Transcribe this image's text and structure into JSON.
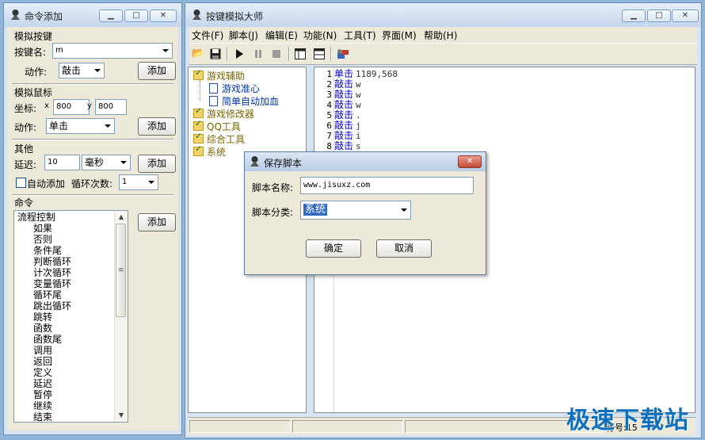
{
  "left_window": {
    "title": "命令添加",
    "key_group": {
      "title": "模拟按键",
      "key_label": "按键名:",
      "key_value": "m",
      "action_label": "动作:",
      "action_value": "敲击",
      "add_label": "添加"
    },
    "mouse_group": {
      "title": "模拟鼠标",
      "coord_label": "坐标:",
      "x_label": "x",
      "x_value": "800",
      "y_label": "y",
      "y_value": "800",
      "action_label": "动作:",
      "action_value": "单击",
      "add_label": "添加"
    },
    "other_group": {
      "title": "其他",
      "delay_label": "延迟:",
      "delay_value": "10",
      "unit_value": "毫秒",
      "add_label": "添加",
      "auto_add_label": "自动添加",
      "loop_label": "循环次数:",
      "loop_value": "1"
    },
    "command_group": {
      "title": "命令",
      "add_label": "添加",
      "items": [
        "流程控制",
        "如果",
        "否则",
        "条件尾",
        "判断循环",
        "计次循环",
        "变量循环",
        "循环尾",
        "跳出循环",
        "跳转",
        "函数",
        "函数尾",
        "调用",
        "返回",
        "定义",
        "延迟",
        "暂停",
        "继续",
        "结束"
      ]
    }
  },
  "main_window": {
    "title": "按键模拟大师",
    "menu": [
      "文件(F)",
      "脚本(J)",
      "编辑(E)",
      "功能(N)",
      "工具(T)",
      "界面(M)",
      "帮助(H)"
    ],
    "toolbar_icons": [
      "open-folder-icon",
      "save-icon",
      "play-icon",
      "pause-icon",
      "stop-icon",
      "layout-icon",
      "layout-alt-icon",
      "tool-icon"
    ],
    "tree": [
      {
        "label": "游戏辅助",
        "level": 0
      },
      {
        "label": "游戏准心",
        "level": 1
      },
      {
        "label": "简单自动加血",
        "level": 1
      },
      {
        "label": "游戏修改器",
        "level": 0
      },
      {
        "label": "QQ工具",
        "level": 0
      },
      {
        "label": "综合工具",
        "level": 0
      },
      {
        "label": "系统",
        "level": 0
      }
    ],
    "script_lines": [
      {
        "num": "1",
        "cmd": "单击",
        "arg": "1189,568"
      },
      {
        "num": "2",
        "cmd": "敲击",
        "arg": "w"
      },
      {
        "num": "3",
        "cmd": "敲击",
        "arg": "w"
      },
      {
        "num": "4",
        "cmd": "敲击",
        "arg": "w"
      },
      {
        "num": "5",
        "cmd": "敲击",
        "arg": "."
      },
      {
        "num": "6",
        "cmd": "敲击",
        "arg": "j"
      },
      {
        "num": "7",
        "cmd": "敲击",
        "arg": "i"
      },
      {
        "num": "8",
        "cmd": "敲击",
        "arg": "s"
      }
    ],
    "status_line": "行号:15"
  },
  "dialog": {
    "title": "保存脚本",
    "name_label": "脚本名称:",
    "name_value": "www.jisuxz.com",
    "category_label": "脚本分类:",
    "category_value": "系统",
    "ok_label": "确定",
    "cancel_label": "取消"
  },
  "watermark": "极速下载站",
  "colors": {
    "desktop": "#8fb6d9",
    "accent": "#0f6fbe",
    "keyword": "#0000cc"
  }
}
